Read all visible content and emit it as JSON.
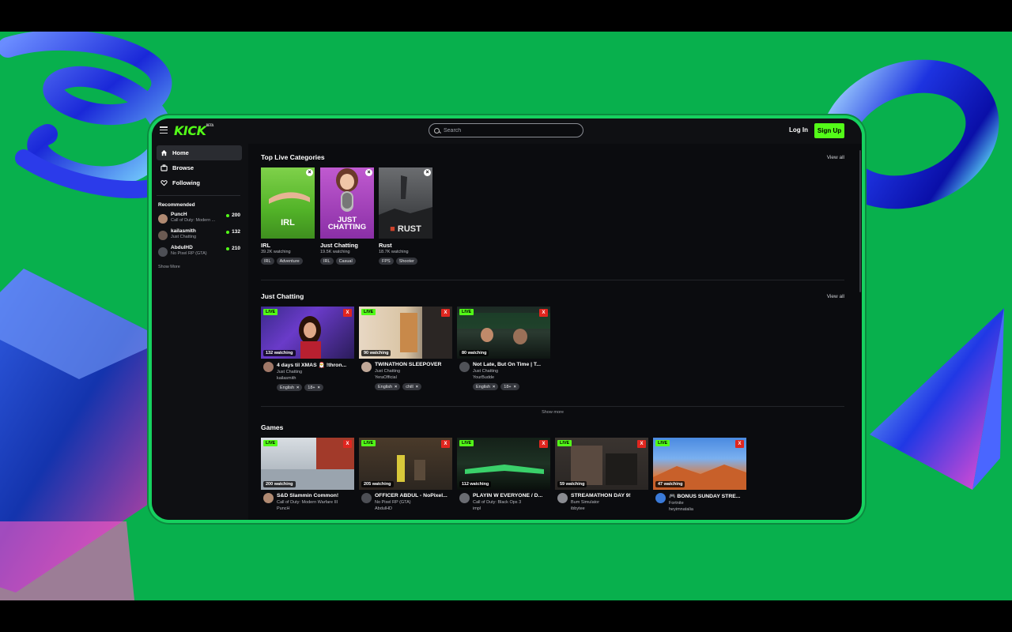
{
  "header": {
    "logo": "KICK",
    "logo_badge": "BETA",
    "search_placeholder": "Search",
    "login_label": "Log In",
    "signup_label": "Sign Up"
  },
  "sidebar": {
    "nav": [
      {
        "label": "Home",
        "icon": "home-icon"
      },
      {
        "label": "Browse",
        "icon": "browse-icon"
      },
      {
        "label": "Following",
        "icon": "heart-icon"
      }
    ],
    "recommended_title": "Recommended",
    "recommended": [
      {
        "name": "PuncH",
        "category": "Call of Duty: Modern ...",
        "viewers": "200"
      },
      {
        "name": "kailasmith",
        "category": "Just Chatting",
        "viewers": "132"
      },
      {
        "name": "AbdulHD",
        "category": "No Pixel RP (GTA)",
        "viewers": "210"
      }
    ],
    "show_more": "Show More"
  },
  "top_categories": {
    "title": "Top Live Categories",
    "view_all": "View all",
    "items": [
      {
        "name": "IRL",
        "watching": "39.2K watching",
        "tags": [
          "IRL",
          "Adventure"
        ],
        "art_text": "IRL"
      },
      {
        "name": "Just Chatting",
        "watching": "19.5K watching",
        "tags": [
          "IRL",
          "Casual"
        ],
        "art_text": "JUST CHATTING"
      },
      {
        "name": "Rust",
        "watching": "18.7K watching",
        "tags": [
          "FPS",
          "Shooter"
        ],
        "art_text": "RUST"
      }
    ]
  },
  "just_chatting": {
    "title": "Just Chatting",
    "view_all": "View all",
    "show_more": "Show more",
    "live_label": "LIVE",
    "close_label": "X",
    "streams": [
      {
        "watching": "132 watching",
        "title": "4 days til XMAS 🎅 !thron...",
        "category": "Just Chatting",
        "user": "kailasmith",
        "tags": [
          "English",
          "18+"
        ]
      },
      {
        "watching": "90 watching",
        "title": "TWINATHON SLEEPOVER",
        "category": "Just Chatting",
        "user": "YeraOfficial",
        "tags": [
          "English",
          "chill"
        ]
      },
      {
        "watching": "80 watching",
        "title": "Not Late, But On Time | T...",
        "category": "Just Chatting",
        "user": "YourBudde",
        "tags": [
          "English",
          "18+"
        ]
      }
    ]
  },
  "games": {
    "title": "Games",
    "live_label": "LIVE",
    "close_label": "X",
    "streams": [
      {
        "watching": "200 watching",
        "title": "S&D Slammin Common!",
        "category": "Call of Duty: Modern Warfare III",
        "user": "PuncH"
      },
      {
        "watching": "205 watching",
        "title": "OFFICER ABDUL - NoPixel...",
        "category": "No Pixel RP (GTA)",
        "user": "AbdulHD"
      },
      {
        "watching": "112 watching",
        "title": "PLAYIN W EVERYONE / D...",
        "category": "Call of Duty: Black Ops 3",
        "user": "impl"
      },
      {
        "watching": "59 watching",
        "title": "STREAMATHON DAY 9!",
        "category": "Bum Simulator",
        "user": "ibbytee"
      },
      {
        "watching": "47 watching",
        "title": "🎮 BONUS SUNDAY STRE...",
        "category": "Fortnite",
        "user": "heyimnatalia"
      }
    ]
  },
  "colors": {
    "brand": "#53fc18",
    "background_green": "#08b04d",
    "screen_bg": "#0b0c0f",
    "close_red": "#e0261f"
  }
}
